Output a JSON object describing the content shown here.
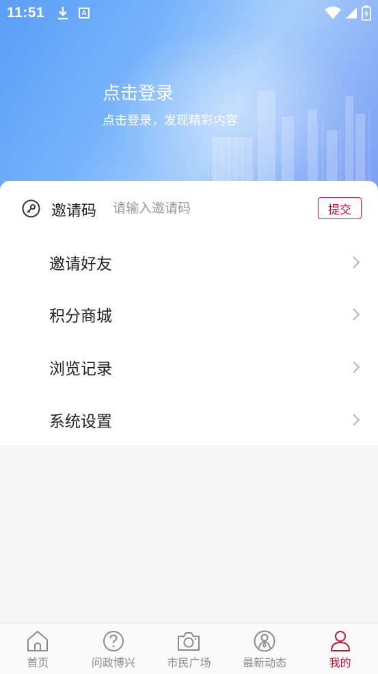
{
  "status_bar": {
    "time": "11:51",
    "notification_icons": [
      "download-icon",
      "a-icon"
    ],
    "system_icons": [
      "wifi-icon",
      "signal-icon",
      "battery-icon"
    ]
  },
  "header": {
    "login_title": "点击登录",
    "login_subtitle": "点击登录，发现精彩内容"
  },
  "invite": {
    "label": "邀请码",
    "placeholder": "请输入邀请码",
    "submit_label": "提交"
  },
  "menu": [
    {
      "label": "邀请好友"
    },
    {
      "label": "积分商城"
    },
    {
      "label": "浏览记录"
    },
    {
      "label": "系统设置"
    }
  ],
  "tabs": [
    {
      "label": "首页",
      "icon": "home-icon",
      "active": false
    },
    {
      "label": "问政博兴",
      "icon": "question-icon",
      "active": false
    },
    {
      "label": "市民广场",
      "icon": "camera-icon",
      "active": false
    },
    {
      "label": "最新动态",
      "icon": "user-circle-icon",
      "active": false
    },
    {
      "label": "我的",
      "icon": "person-icon",
      "active": true
    }
  ],
  "colors": {
    "accent": "#c8102e",
    "header_blue": "#77b3fb",
    "tab_inactive": "#8a8a8a"
  }
}
